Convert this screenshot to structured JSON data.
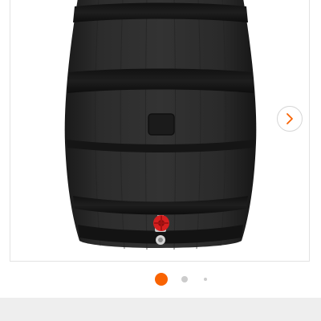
{
  "product_image": {
    "subject": "rain barrel",
    "icon": "barrel-image"
  },
  "carousel": {
    "next_icon": "chevron-right-icon",
    "slide_count": 3,
    "active_index": 0,
    "colors": {
      "active_dot": "#f96302",
      "inactive_dot": "#cccccc",
      "chevron": "#f96302",
      "frame_border": "#e3e3e3",
      "band": "#eeeeee"
    }
  }
}
